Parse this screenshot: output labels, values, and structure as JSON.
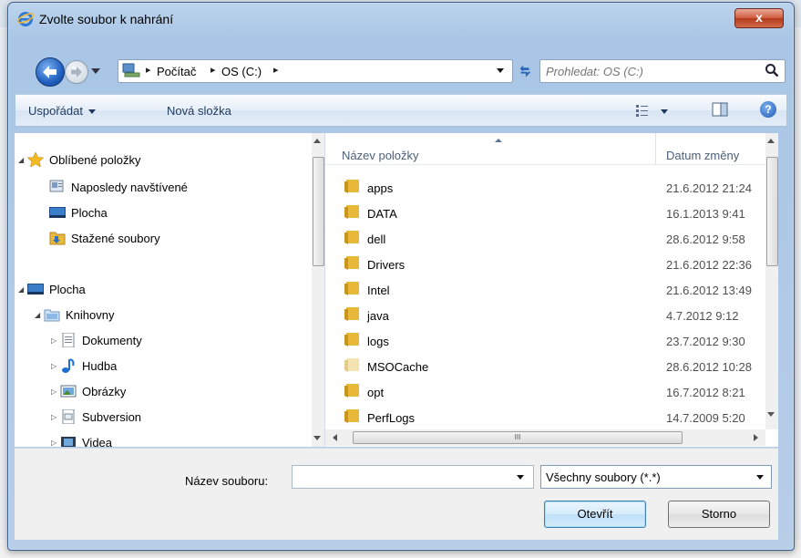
{
  "window": {
    "title": "Zvolte soubor k nahrání",
    "close_label": "x"
  },
  "address": {
    "segments": [
      "Počítač",
      "OS (C:)"
    ],
    "search_placeholder": "Prohledat: OS (C:)"
  },
  "toolbar": {
    "organize_label": "Uspořádat",
    "new_folder_label": "Nová složka"
  },
  "nav": {
    "favorites_label": "Oblíbené položky",
    "recent_label": "Naposledy navštívené",
    "desktop_label": "Plocha",
    "downloads_label": "Stažené soubory",
    "desktop_root_label": "Plocha",
    "libraries_label": "Knihovny",
    "documents_label": "Dokumenty",
    "music_label": "Hudba",
    "pictures_label": "Obrázky",
    "subversion_label": "Subversion",
    "videos_label": "Videa"
  },
  "files": {
    "header_name": "Název položky",
    "header_date": "Datum změny",
    "scroll_grip": "III",
    "rows": [
      {
        "name": "apps",
        "date": "21.6.2012 21:24"
      },
      {
        "name": "DATA",
        "date": "16.1.2013 9:41"
      },
      {
        "name": "dell",
        "date": "28.6.2012 9:58"
      },
      {
        "name": "Drivers",
        "date": "21.6.2012 22:36"
      },
      {
        "name": "Intel",
        "date": "21.6.2012 13:49"
      },
      {
        "name": "java",
        "date": "4.7.2012 9:12"
      },
      {
        "name": "logs",
        "date": "23.7.2012 9:30"
      },
      {
        "name": "MSOCache",
        "date": "28.6.2012 10:28"
      },
      {
        "name": "opt",
        "date": "16.7.2012 8:21"
      },
      {
        "name": "PerfLogs",
        "date": "14.7.2009 5:20"
      }
    ]
  },
  "bottom": {
    "filename_label": "Název souboru:",
    "filename_value": "",
    "filetype_value": "Všechny soubory (*.*)",
    "open_label": "Otevřít",
    "cancel_label": "Storno"
  },
  "colors": {
    "folder": "#e8b93a",
    "folder_hidden": "#f3e3b0",
    "accent": "#1e395b"
  }
}
